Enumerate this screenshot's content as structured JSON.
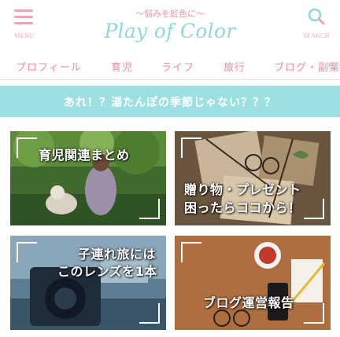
{
  "header": {
    "menu_label": "MENU",
    "tagline": "〜悩みを虹色に〜",
    "site_title": "Play of Color",
    "search_label": "SEARCH"
  },
  "nav": {
    "items": [
      "プロフィール",
      "育児",
      "ライフ",
      "旅行",
      "ブログ・副業"
    ],
    "scroll_indicator": "›"
  },
  "notice": {
    "text": "あれ！？湯たんぽの季節じゃない？？？"
  },
  "cards": [
    {
      "title_lines": [
        "育児関連まとめ"
      ]
    },
    {
      "title_lines": [
        "贈り物・プレゼント",
        "困ったらココから！"
      ]
    },
    {
      "title_lines": [
        "子連れ旅には",
        "このレンズを1本"
      ]
    },
    {
      "title_lines": [
        "ブログ運営報告"
      ]
    }
  ],
  "colors": {
    "accent_pink": "#f08ca0",
    "accent_teal": "#9ee0e1",
    "title_teal": "#8fd8d8"
  }
}
